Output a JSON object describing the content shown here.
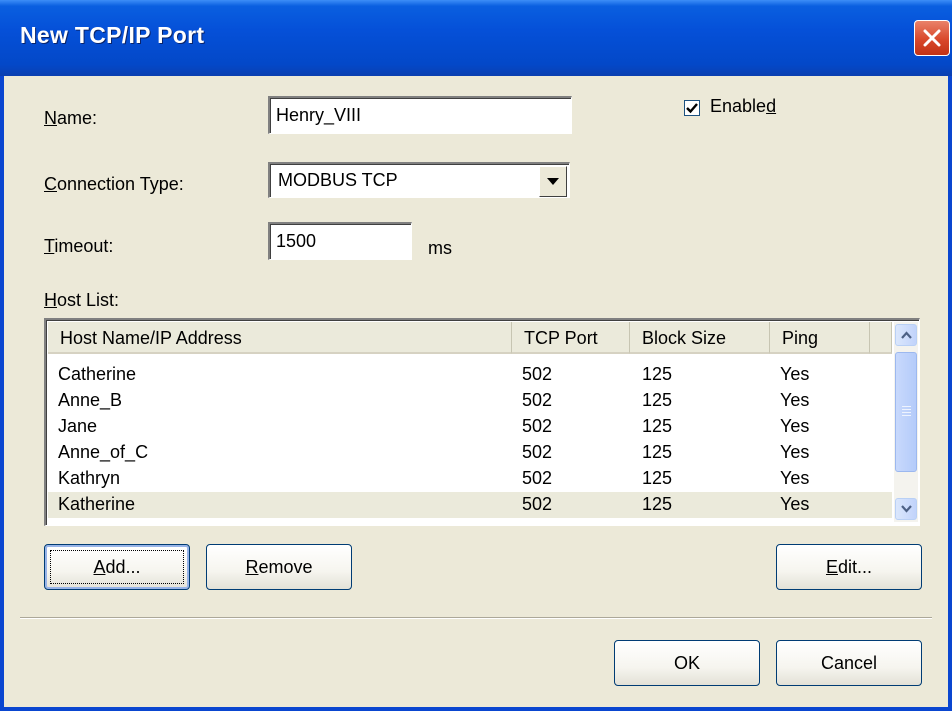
{
  "window": {
    "title": "New TCP/IP Port"
  },
  "form": {
    "name_label": "Name:",
    "name_value": "Henry_VIII",
    "enabled_label": "Enabled",
    "enabled_checked": true,
    "connection_type_label": "Connection Type:",
    "connection_type_value": "MODBUS TCP",
    "timeout_label": "Timeout:",
    "timeout_value": "1500",
    "timeout_unit": "ms",
    "host_list_label": "Host List:"
  },
  "host_list": {
    "columns": [
      "Host Name/IP Address",
      "TCP Port",
      "Block Size",
      "Ping"
    ],
    "rows": [
      {
        "host": "Catherine",
        "port": "502",
        "block": "125",
        "ping": "Yes"
      },
      {
        "host": "Anne_B",
        "port": "502",
        "block": "125",
        "ping": "Yes"
      },
      {
        "host": "Jane",
        "port": "502",
        "block": "125",
        "ping": "Yes"
      },
      {
        "host": "Anne_of_C",
        "port": "502",
        "block": "125",
        "ping": "Yes"
      },
      {
        "host": "Kathryn",
        "port": "502",
        "block": "125",
        "ping": "Yes"
      },
      {
        "host": "Katherine",
        "port": "502",
        "block": "125",
        "ping": "Yes"
      }
    ],
    "selected_index": 5
  },
  "buttons": {
    "add": "Add...",
    "remove": "Remove",
    "edit": "Edit...",
    "ok": "OK",
    "cancel": "Cancel"
  },
  "icons": {
    "close": "close-icon",
    "dropdown": "chevron-down-icon",
    "scroll_up": "chevron-up-icon",
    "scroll_down": "chevron-down-icon",
    "check": "checkmark-icon"
  },
  "colors": {
    "titlebar": "#0550d8",
    "close_button": "#d9482b",
    "dialog_bg": "#ece9d8",
    "selected_row": "#ebeadb"
  }
}
